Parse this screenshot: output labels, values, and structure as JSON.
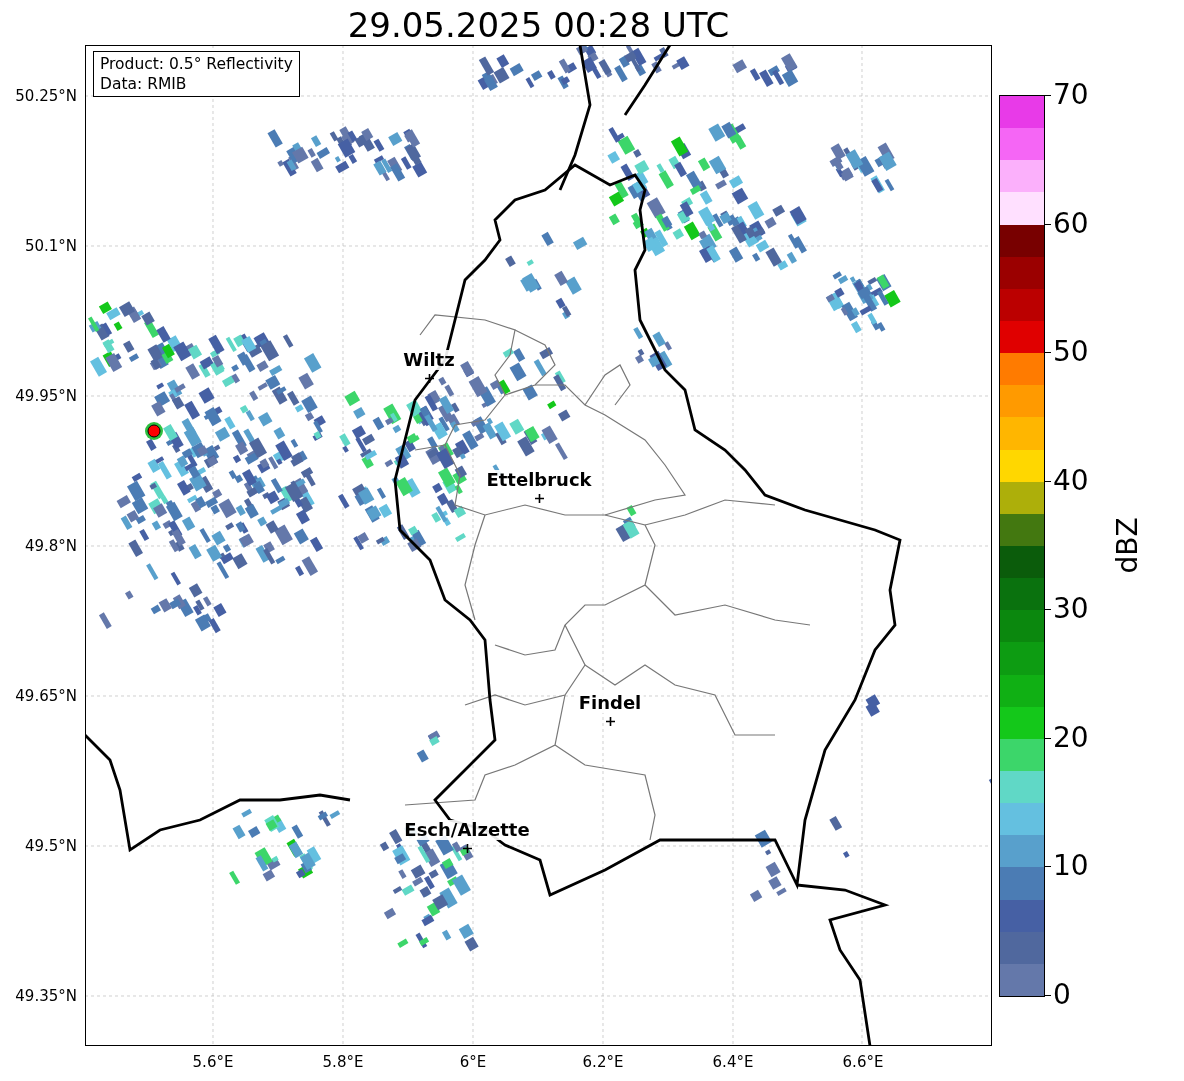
{
  "title": "29.05.2025 00:28 UTC",
  "info_box": {
    "lines": [
      "Product: 0.5° Reflectivity",
      "Data: RMIB"
    ]
  },
  "map": {
    "y_ticks": [
      "50.25°N",
      "50.1°N",
      "49.95°N",
      "49.8°N",
      "49.65°N",
      "49.5°N",
      "49.35°N"
    ],
    "x_ticks": [
      "5.6°E",
      "5.8°E",
      "6°E",
      "6.2°E",
      "6.4°E",
      "6.6°E"
    ],
    "cities": [
      {
        "name": "Wiltz"
      },
      {
        "name": "Ettelbruck"
      },
      {
        "name": "Findel"
      },
      {
        "name": "Esch/Alzette"
      }
    ]
  },
  "colorbar": {
    "label": "dBZ",
    "ticks": [
      "70",
      "60",
      "50",
      "40",
      "30",
      "20",
      "10",
      "0"
    ],
    "bands": [
      {
        "color": "#e83ae8"
      },
      {
        "color": "#f566f5"
      },
      {
        "color": "#fbb0fb"
      },
      {
        "color": "#ffe0ff"
      },
      {
        "color": "#780000"
      },
      {
        "color": "#9b0000"
      },
      {
        "color": "#bb0000"
      },
      {
        "color": "#e00000"
      },
      {
        "color": "#ff7b00"
      },
      {
        "color": "#ff9a00"
      },
      {
        "color": "#ffb600"
      },
      {
        "color": "#ffd700"
      },
      {
        "color": "#adaf0a"
      },
      {
        "color": "#437810"
      },
      {
        "color": "#0b5c0b"
      },
      {
        "color": "#0a720e"
      },
      {
        "color": "#0b880e"
      },
      {
        "color": "#0d9c12"
      },
      {
        "color": "#10b014"
      },
      {
        "color": "#14c81a"
      },
      {
        "color": "#3cd66a"
      },
      {
        "color": "#60d8c6"
      },
      {
        "color": "#64c0e0"
      },
      {
        "color": "#58a0cc"
      },
      {
        "color": "#4b7cb4"
      },
      {
        "color": "#4660a4"
      },
      {
        "color": "#50689e"
      },
      {
        "color": "#6478aa"
      }
    ]
  }
}
